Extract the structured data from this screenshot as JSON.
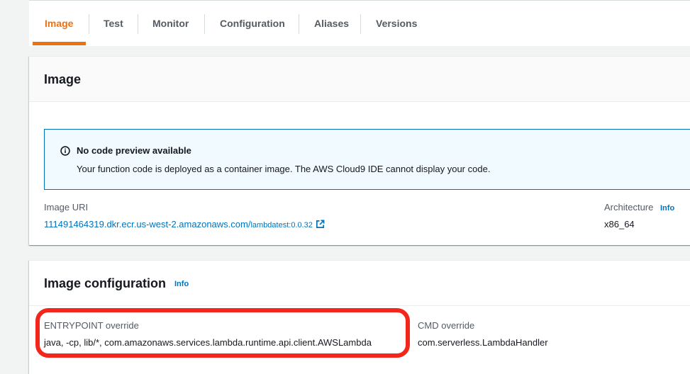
{
  "tabs": [
    {
      "label": "Image",
      "active": true
    },
    {
      "label": "Test"
    },
    {
      "label": "Monitor"
    },
    {
      "label": "Configuration"
    },
    {
      "label": "Aliases"
    },
    {
      "label": "Versions"
    }
  ],
  "image_panel": {
    "title": "Image",
    "alert": {
      "icon": "info-circle-icon",
      "title": "No code preview available",
      "text": "Your function code is deployed as a container image. The AWS Cloud9 IDE cannot display your code."
    },
    "image_uri": {
      "label": "Image URI",
      "value_main": "111491464319.dkr.ecr.us-west-2.amazonaws.com/",
      "value_suffix": "lambdatest:0.0.32",
      "icon": "external-link-icon"
    },
    "architecture": {
      "label": "Architecture",
      "info": "Info",
      "value": "x86_64"
    }
  },
  "image_config_panel": {
    "title": "Image configuration",
    "info": "Info",
    "entrypoint": {
      "label": "ENTRYPOINT override",
      "value": "java, -cp, lib/*, com.amazonaws.services.lambda.runtime.api.client.AWSLambda"
    },
    "cmd": {
      "label": "CMD override",
      "value": "com.serverless.LambdaHandler"
    }
  },
  "colors": {
    "accent": "#ec7211",
    "link": "#0073bb",
    "highlight": "#f2261b"
  }
}
